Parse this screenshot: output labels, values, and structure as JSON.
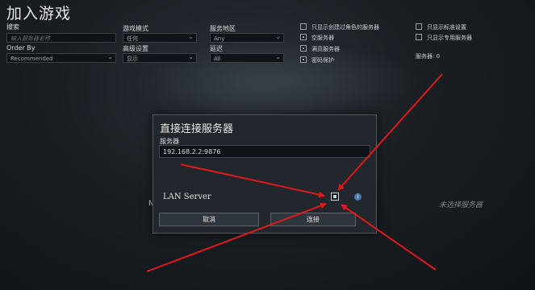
{
  "page": {
    "title": "加入游戏"
  },
  "filters": {
    "search_label": "搜索",
    "search_placeholder": "输入服务器名称",
    "order_by_label": "Order By",
    "order_by_value": "Recommended",
    "game_mode_label": "游戏模式",
    "game_mode_value": "任何",
    "advanced_label": "高级设置",
    "advanced_value": "显示",
    "region_label": "服务地区",
    "region_value": "Any",
    "latency_label": "延迟",
    "latency_value": "All",
    "checks": [
      {
        "label": "只显示创建过角色的服务器",
        "checked": false
      },
      {
        "label": "空服务器",
        "checked": true
      },
      {
        "label": "满员服务器",
        "checked": true
      },
      {
        "label": "密码保护",
        "checked": true
      }
    ],
    "checks_right": [
      {
        "label": "只显示标准设置",
        "checked": false
      },
      {
        "label": "只显示专用服务器",
        "checked": false
      }
    ],
    "server_count": "服务器: 0"
  },
  "status": {
    "no_server_selected": "未选择服务器"
  },
  "dialog": {
    "title": "直接连接服务器",
    "server_label": "服务器",
    "server_value": "192.168.2.2:9876",
    "lan_label": "LAN Server",
    "lan_checked": true,
    "cancel_label": "取消",
    "connect_label": "连接"
  },
  "background_fragment": "N",
  "colors": {
    "arrow": "#e0191b",
    "info": "#4a78b0"
  }
}
